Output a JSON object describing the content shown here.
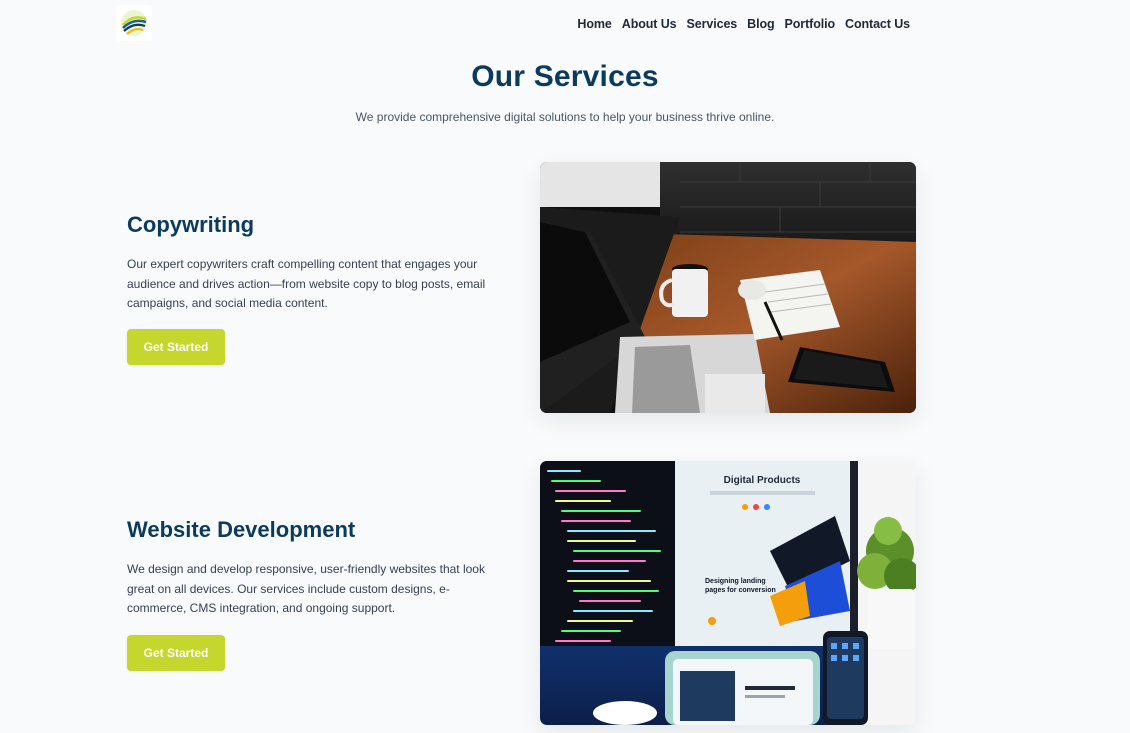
{
  "header": {
    "logo_icon": "circular-swoosh-logo",
    "nav": [
      {
        "label": "Home"
      },
      {
        "label": "About Us"
      },
      {
        "label": "Services"
      },
      {
        "label": "Blog"
      },
      {
        "label": "Portfolio"
      },
      {
        "label": "Contact Us"
      }
    ]
  },
  "hero": {
    "title": "Our Services",
    "subtitle": "We provide comprehensive digital solutions to help your business thrive online."
  },
  "services": [
    {
      "title": "Copywriting",
      "description": "Our expert copywriters craft compelling content that engages your audience and drives action—from website copy to blog posts, email campaigns, and social media content.",
      "button": "Get Started",
      "image_icon": "laptop-desk-photo"
    },
    {
      "title": "Website Development",
      "description": "We design and develop responsive, user-friendly websites that look great on all devices. Our services include custom designs, e-commerce, CMS integration, and ongoing support.",
      "button": "Get Started",
      "image_icon": "monitor-code-photo",
      "image_text": {
        "screen_title": "Digital Products",
        "screen_heading": "Designing landing pages for conversion"
      }
    }
  ],
  "colors": {
    "heading": "#0b3a5f",
    "accent": "#c5d62c",
    "background": "#f8fafc"
  }
}
